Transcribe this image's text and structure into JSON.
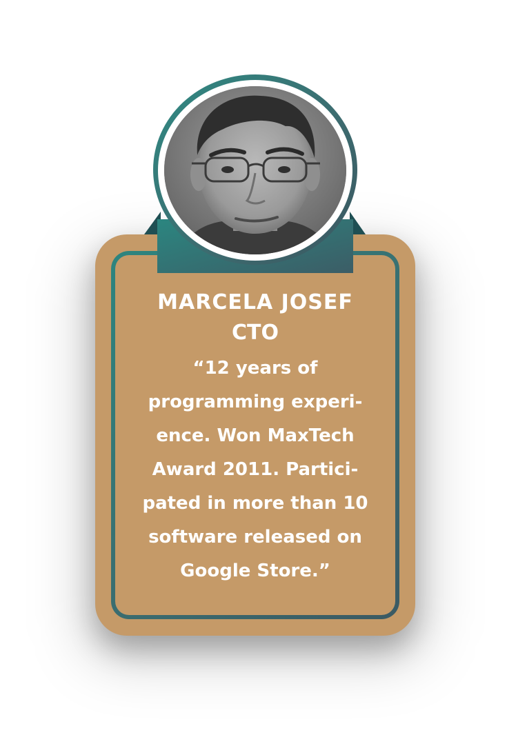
{
  "profile": {
    "name": "MARCELA JOSEF",
    "role": "CTO",
    "quote_lines": [
      "“12 years of",
      "programming experi-",
      "ence. Won MaxTech",
      "Award 2011. Partici-",
      "pated in more than 10",
      "software released on",
      "Google Store.”"
    ]
  },
  "colors": {
    "card": "#c59a68",
    "accent_teal": "#2d857f",
    "accent_dark": "#3b5a63",
    "text": "#ffffff"
  }
}
